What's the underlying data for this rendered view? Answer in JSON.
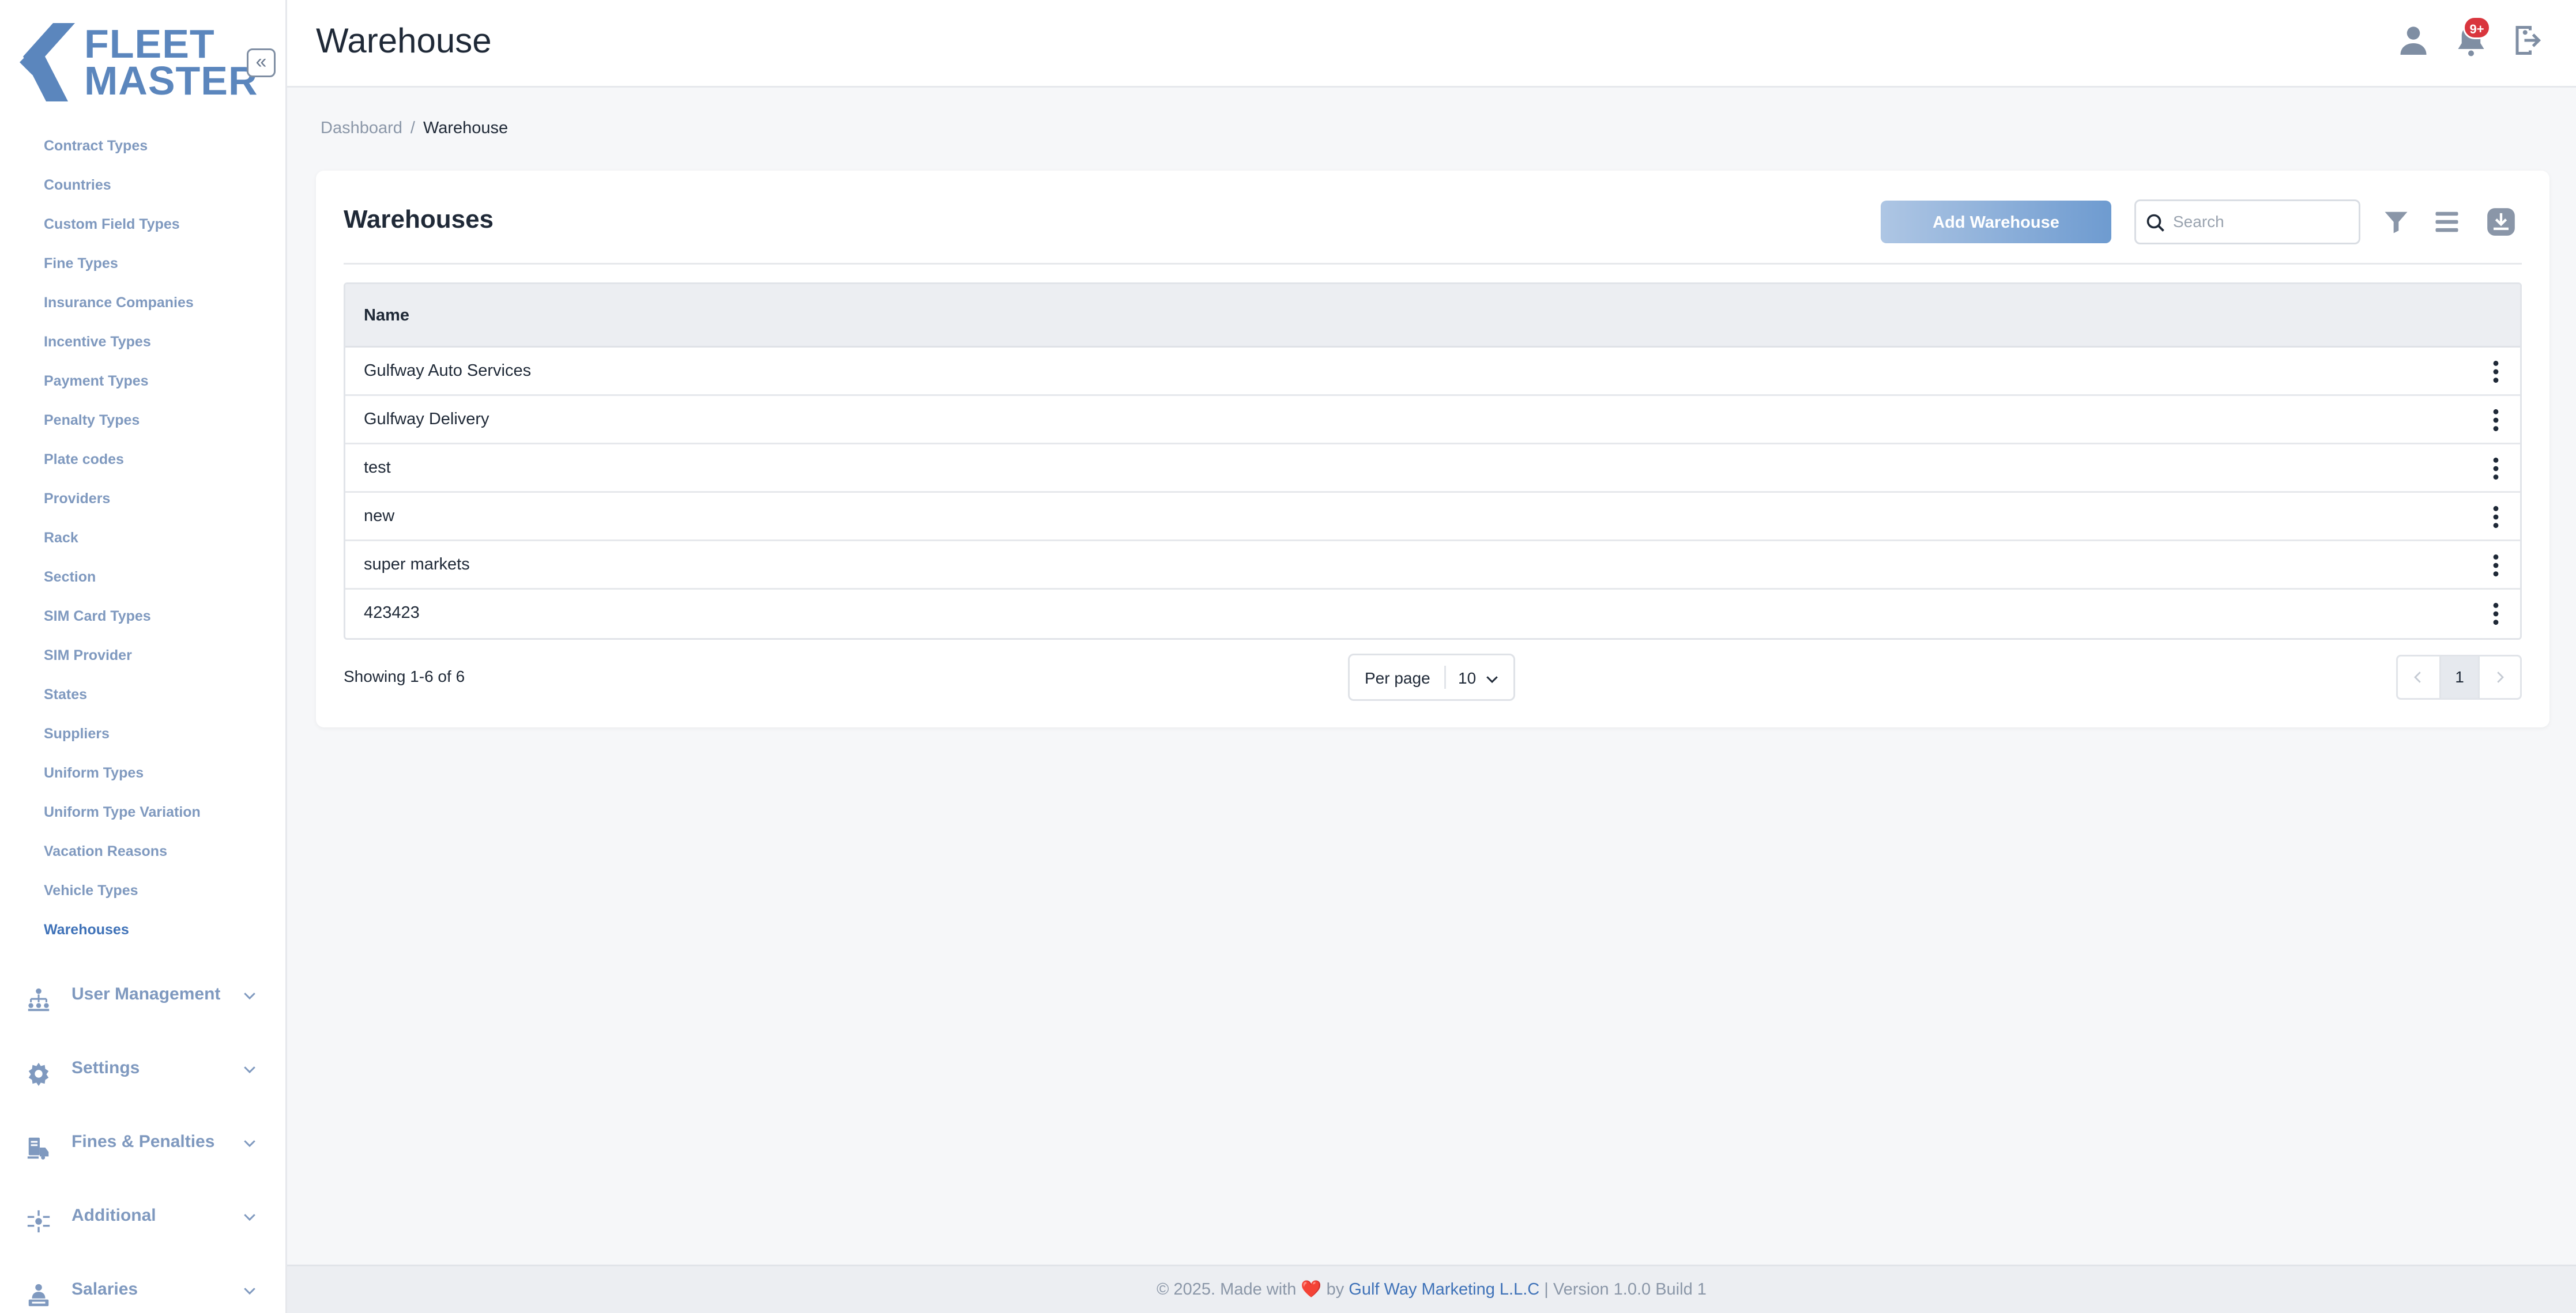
{
  "app": {
    "logo_line1": "FLEET",
    "logo_line2": "MASTER",
    "collapse_glyph": "«"
  },
  "sidebar": {
    "sub_items": [
      {
        "label": "Contract Types"
      },
      {
        "label": "Countries"
      },
      {
        "label": "Custom Field Types"
      },
      {
        "label": "Fine Types"
      },
      {
        "label": "Insurance Companies"
      },
      {
        "label": "Incentive Types"
      },
      {
        "label": "Payment Types"
      },
      {
        "label": "Penalty Types"
      },
      {
        "label": "Plate codes"
      },
      {
        "label": "Providers"
      },
      {
        "label": "Rack"
      },
      {
        "label": "Section"
      },
      {
        "label": "SIM Card Types"
      },
      {
        "label": "SIM Provider"
      },
      {
        "label": "States"
      },
      {
        "label": "Suppliers"
      },
      {
        "label": "Uniform Types"
      },
      {
        "label": "Uniform Type Variation"
      },
      {
        "label": "Vacation Reasons"
      },
      {
        "label": "Vehicle Types"
      },
      {
        "label": "Warehouses",
        "active": true
      }
    ],
    "groups": [
      {
        "label": "User Management",
        "icon": "org-chart-icon"
      },
      {
        "label": "Settings",
        "icon": "gear-icon"
      },
      {
        "label": "Fines & Penalties",
        "icon": "fines-icon"
      },
      {
        "label": "Additional",
        "icon": "additional-icon"
      },
      {
        "label": "Salaries",
        "icon": "salaries-icon"
      }
    ]
  },
  "header": {
    "title": "Warehouse",
    "notification_badge": "9+"
  },
  "breadcrumb": {
    "root": "Dashboard",
    "separator": "/",
    "current": "Warehouse"
  },
  "card": {
    "title": "Warehouses",
    "add_button_label": "Add Warehouse",
    "search_placeholder": "Search"
  },
  "table": {
    "column_name": "Name",
    "rows": [
      {
        "name": "Gulfway Auto Services"
      },
      {
        "name": "Gulfway Delivery"
      },
      {
        "name": "test"
      },
      {
        "name": "new"
      },
      {
        "name": "super markets"
      },
      {
        "name": "423423"
      }
    ]
  },
  "pagination": {
    "showing": "Showing 1-6 of 6",
    "per_page_label": "Per page",
    "per_page_value": "10",
    "current_page": "1"
  },
  "footer": {
    "prefix": "© 2025. Made with",
    "heart": "❤️",
    "by": "by",
    "company": "Gulf Way Marketing L.L.C",
    "version": "| Version 1.0.0 Build 1"
  },
  "colors": {
    "accent": "#3f72b8",
    "sidebar_text": "#7f99bf",
    "button_start": "#aec6e4",
    "button_end": "#6e9bd0",
    "badge": "#d9363e"
  }
}
